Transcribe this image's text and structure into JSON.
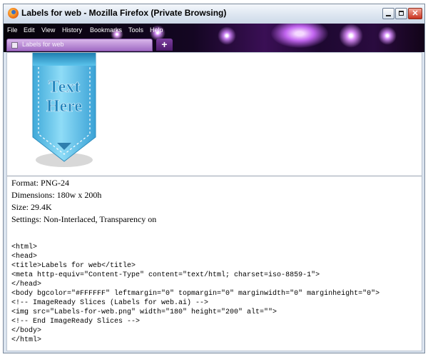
{
  "window": {
    "title": "Labels for web - Mozilla Firefox (Private Browsing)"
  },
  "window_controls": {
    "minimize": "minimize",
    "maximize": "maximize",
    "close": "✕"
  },
  "menu": [
    "File",
    "Edit",
    "View",
    "History",
    "Bookmarks",
    "Tools",
    "Help"
  ],
  "tabs": [
    {
      "label": "Labels for web",
      "icon": "page-icon"
    }
  ],
  "new_tab_label": "+",
  "label_graphic": {
    "line1": "Text",
    "line2": "Here",
    "color": "#5bc3ec"
  },
  "info": [
    "Format: PNG-24",
    "Dimensions: 180w x 200h",
    "Size: 29.4K",
    "Settings: Non-Interlaced, Transparency on"
  ],
  "code_lines": [
    "<html>",
    "<head>",
    "<title>Labels for web</title>",
    "<meta http-equiv=\"Content-Type\" content=\"text/html; charset=iso-8859-1\">",
    "</head>",
    "<body bgcolor=\"#FFFFFF\" leftmargin=\"0\" topmargin=\"0\" marginwidth=\"0\" marginheight=\"0\">",
    "<!-- ImageReady Slices (Labels for web.ai) -->",
    "<img src=\"Labels-for-web.png\" width=\"180\" height=\"200\" alt=\"\">",
    "<!-- End ImageReady Slices -->",
    "</body>",
    "</html>"
  ],
  "colors": {
    "theme_purple": "#3a0f55",
    "tab": "#c49ad9",
    "label_blue": "#5bc3ec"
  }
}
